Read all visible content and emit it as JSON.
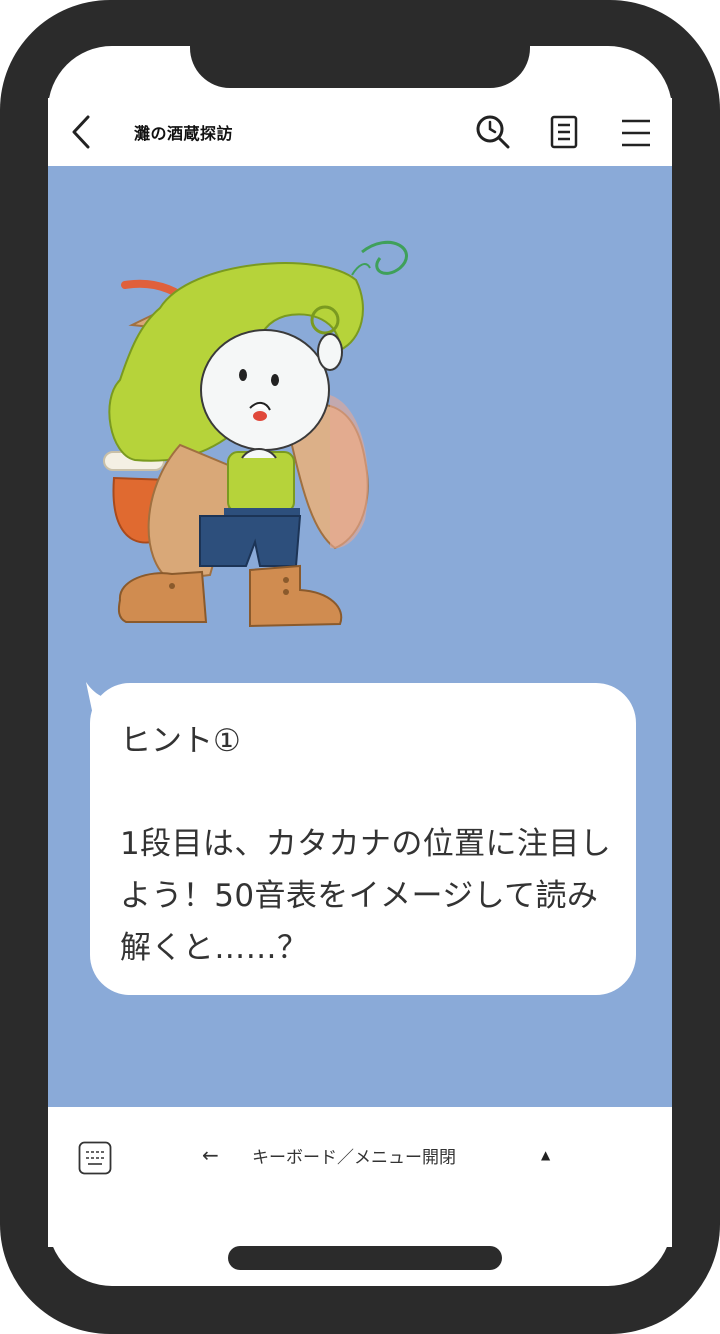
{
  "header": {
    "title": "灘の酒蔵探訪",
    "icons": [
      "back-arrow-icon",
      "search-history-icon",
      "note-icon",
      "menu-icon"
    ]
  },
  "message": {
    "title": "ヒント①",
    "lines": [
      "1段目は、カタカナの位置に注目し",
      "よう！50音表をイメージして読み",
      "解くと……？"
    ]
  },
  "footer": {
    "arrow": "←",
    "label": "キーボード／メニュー開閉",
    "caret": "▲"
  },
  "colors": {
    "chat_background": "#8aaad8",
    "frame": "#2b2b2b",
    "bubble": "#ffffff"
  }
}
